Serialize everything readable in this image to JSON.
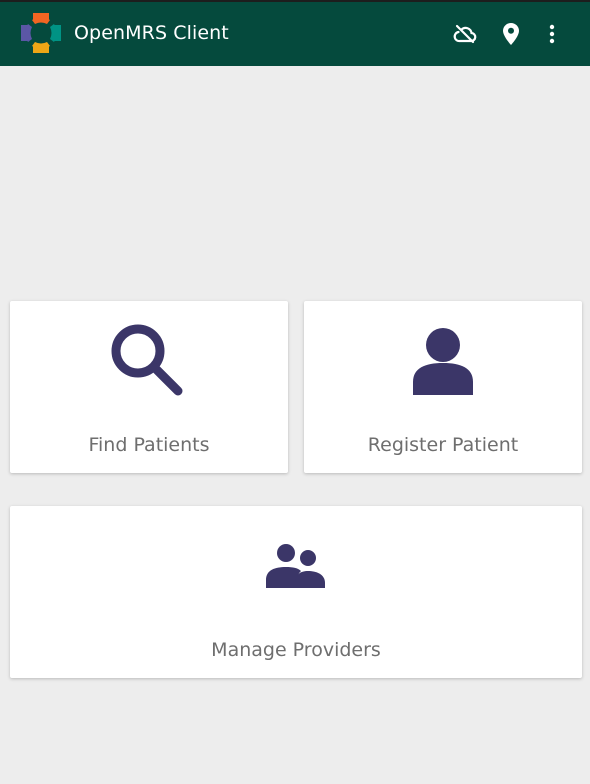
{
  "app": {
    "title": "OpenMRS Client",
    "header_color": "#054a3d"
  },
  "toolbar": {
    "actions": [
      {
        "icon": "cloud-off-icon"
      },
      {
        "icon": "location-pin-icon"
      },
      {
        "icon": "more-vert-icon"
      }
    ]
  },
  "dashboard": {
    "icon_color": "#3b3668",
    "tiles": [
      {
        "icon": "search-icon",
        "label": "Find Patients"
      },
      {
        "icon": "person-icon",
        "label": "Register Patient"
      },
      {
        "icon": "people-icon",
        "label": "Manage Providers"
      }
    ]
  }
}
